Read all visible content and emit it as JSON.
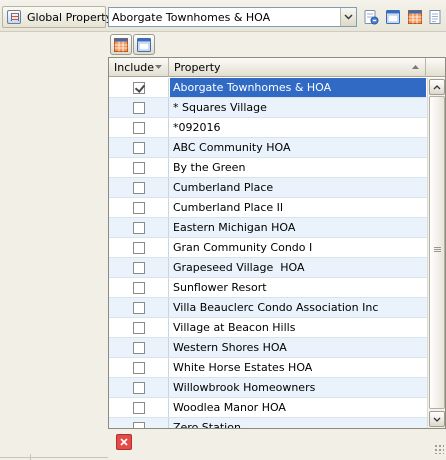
{
  "toolbar": {
    "global_property_label": "Global Property:",
    "global_property_icon": "property-list-icon",
    "selected_property": "Aborgate Townhomes & HOA",
    "dropdown_icon": "chevron-down-icon",
    "buttons": [
      {
        "name": "clear-filter-button",
        "icon": "eraser-icon"
      },
      {
        "name": "window-view-button",
        "icon": "window-icon"
      },
      {
        "name": "grid-view-button",
        "icon": "grid-icon"
      },
      {
        "name": "document-button",
        "icon": "document-icon"
      }
    ]
  },
  "table_toolbar": {
    "buttons": [
      {
        "name": "select-all-button",
        "icon": "grid-icon"
      },
      {
        "name": "clear-selection-button",
        "icon": "window-icon"
      }
    ]
  },
  "table": {
    "columns": [
      "Include",
      "Property"
    ],
    "sort_column": "Property",
    "sort_direction": "ascending",
    "rows": [
      {
        "include": true,
        "property": "Aborgate Townhomes & HOA",
        "selected": true
      },
      {
        "include": false,
        "property": "* Squares Village"
      },
      {
        "include": false,
        "property": "*092016"
      },
      {
        "include": false,
        "property": "ABC Community HOA"
      },
      {
        "include": false,
        "property": "By the Green"
      },
      {
        "include": false,
        "property": "Cumberland Place"
      },
      {
        "include": false,
        "property": "Cumberland Place II"
      },
      {
        "include": false,
        "property": "Eastern Michigan HOA"
      },
      {
        "include": false,
        "property": "Gran Community Condo I"
      },
      {
        "include": false,
        "property": "Grapeseed Village  HOA"
      },
      {
        "include": false,
        "property": "Sunflower Resort"
      },
      {
        "include": false,
        "property": "Villa Beauclerc Condo Association Inc"
      },
      {
        "include": false,
        "property": "Village at Beacon Hills"
      },
      {
        "include": false,
        "property": "Western Shores HOA"
      },
      {
        "include": false,
        "property": "White Horse Estates HOA"
      },
      {
        "include": false,
        "property": "Willowbrook Homeowners"
      },
      {
        "include": false,
        "property": "Woodlea Manor HOA"
      },
      {
        "include": false,
        "property": "Zero Station"
      }
    ]
  },
  "footer": {
    "delete_icon": "close-icon"
  },
  "colors": {
    "selection": "#316ac5",
    "row_alt": "#eaf3fb",
    "toolbar_bg": "#f2f0e6",
    "delete_red": "#e24b47"
  }
}
